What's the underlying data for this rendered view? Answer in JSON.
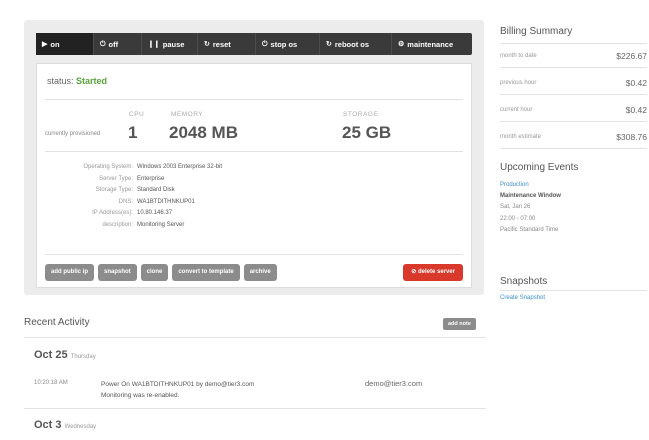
{
  "toolbar": {
    "buttons": [
      {
        "icon": "play-icon",
        "glyph": "▶",
        "label": "on"
      },
      {
        "icon": "power-icon",
        "glyph": "⏻",
        "label": "off"
      },
      {
        "icon": "pause-icon",
        "glyph": "❙❙",
        "label": "pause"
      },
      {
        "icon": "reset-icon",
        "glyph": "↻",
        "label": "reset"
      },
      {
        "icon": "power-icon",
        "glyph": "⏻",
        "label": "stop os"
      },
      {
        "icon": "reboot-icon",
        "glyph": "↻",
        "label": "reboot os"
      },
      {
        "icon": "gear-icon",
        "glyph": "⚙",
        "label": "maintenance"
      }
    ]
  },
  "server": {
    "status_label": "status:",
    "status_value": "Started",
    "provisioned_label": "currently provisioned",
    "cpu_label": "CPU",
    "cpu_value": "1",
    "memory_label": "MEMORY",
    "memory_value": "2048 MB",
    "storage_label": "STORAGE",
    "storage_value": "25 GB",
    "details": [
      {
        "key": "Operating System:",
        "value": "Windows 2003 Enterprise 32-bit"
      },
      {
        "key": "Server Type:",
        "value": "Enterprise"
      },
      {
        "key": "Storage Type:",
        "value": "Standard Disk"
      },
      {
        "key": "DNS:",
        "value": "WA1BTDITHNKUP01"
      },
      {
        "key": "IP Address(es):",
        "value": "10.80.146.37"
      },
      {
        "key": "description:",
        "value": "Monitoring Server"
      }
    ]
  },
  "actions": {
    "buttons": [
      "add public ip",
      "snapshot",
      "clone",
      "convert to template",
      "archive"
    ],
    "delete_label": "delete server",
    "delete_icon": "delete-icon"
  },
  "activity": {
    "title": "Recent Activity",
    "add_note_label": "add note",
    "days": [
      {
        "date": "Oct 25",
        "weekday": "Thursday"
      },
      {
        "date": "Oct 3",
        "weekday": "Wednesday"
      }
    ],
    "event": {
      "time": "10:20:18 AM",
      "text_line1": "Power On WA1BTDITHNKUP01 by demo@tier3.com",
      "text_line2": "Monitoring was re-enabled.",
      "user": "demo@tier3.com"
    }
  },
  "billing": {
    "title": "Billing Summary",
    "rows": [
      {
        "label": "month to date",
        "value": "$226.67"
      },
      {
        "label": "previous hour",
        "value": "$0.42"
      },
      {
        "label": "current hour",
        "value": "$0.42"
      },
      {
        "label": "month estimate",
        "value": "$308.76"
      }
    ]
  },
  "upcoming": {
    "title": "Upcoming Events",
    "link": "Production",
    "name": "Maintenance Window",
    "date": "Sat, Jan 26",
    "time": "22:00 - 07:00",
    "timezone": "Pacific Standard Time"
  },
  "snapshots": {
    "title": "Snapshots",
    "link": "Create Snapshot"
  },
  "colors": {
    "accent_green": "#56a33a",
    "danger_red": "#d8392b",
    "link_blue": "#3a8fc9",
    "toolbar_dark": "#3a3a3a"
  }
}
